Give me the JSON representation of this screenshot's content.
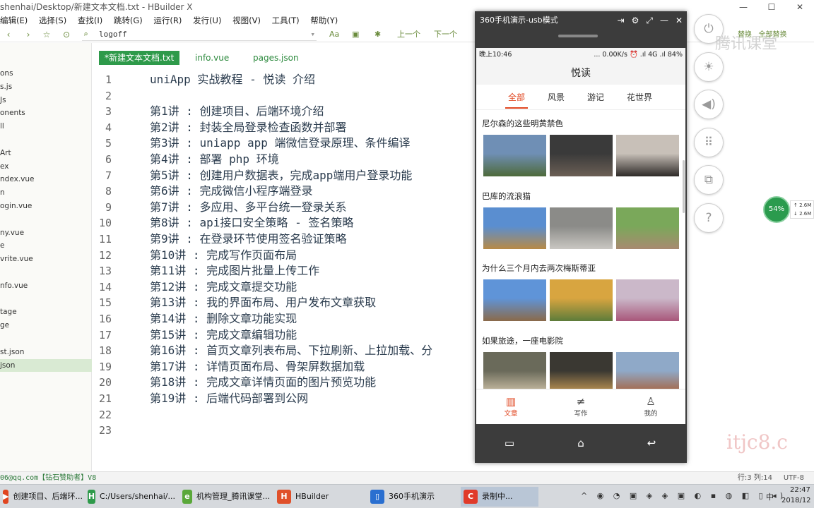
{
  "window": {
    "title": "shenhai/Desktop/新建文本文档.txt - HBuilder X",
    "controls": [
      "—",
      "☐",
      "✕"
    ]
  },
  "menu": [
    "编辑(E)",
    "选择(S)",
    "查找(I)",
    "跳转(G)",
    "运行(R)",
    "发行(U)",
    "视图(V)",
    "工具(T)",
    "帮助(Y)"
  ],
  "toolbar": {
    "address": "logoff",
    "buttons": [
      "Aa",
      "上一个",
      "下一个",
      "替换",
      "全部替换"
    ]
  },
  "sidebar": {
    "files": [
      "ons",
      "s.js",
      "Js",
      "onents",
      "ll",
      "",
      "Art",
      "ex",
      "ndex.vue",
      "n",
      "ogin.vue",
      "",
      "ny.vue",
      "e",
      "vrite.vue",
      "",
      "nfo.vue",
      "",
      "tage",
      "ge",
      "",
      "st.json",
      "json"
    ],
    "selected_index": 22
  },
  "tabs": [
    "*新建文本文档.txt",
    "info.vue",
    "pages.json"
  ],
  "editor": {
    "lines": [
      "uniApp 实战教程 - 悦读 介绍",
      "",
      "第1讲 : 创建项目、后端环境介绍",
      "第2讲 : 封装全局登录检查函数并部署",
      "第3讲 : uniapp app 端微信登录原理、条件编译",
      "第4讲 : 部署 php 环境",
      "第5讲 : 创建用户数据表，完成app端用户登录功能",
      "第6讲 : 完成微信小程序端登录",
      "第7讲 : 多应用、多平台统一登录关系",
      "第8讲 : api接口安全策略 - 签名策略",
      "第9讲 : 在登录环节使用签名验证策略",
      "第10讲 : 完成写作页面布局",
      "第11讲 : 完成图片批量上传工作",
      "第12讲 : 完成文章提交功能",
      "第13讲 : 我的界面布局、用户发布文章获取",
      "第14讲 : 删除文章功能实现",
      "第15讲 : 完成文章编辑功能",
      "第16讲 : 首页文章列表布局、下拉刷新、上拉加载、分",
      "第17讲 : 详情页面布局、骨架屏数据加载",
      "第18讲 : 完成文章详情页面的图片预览功能",
      "第19讲 : 后端代码部署到公网",
      "",
      ""
    ]
  },
  "statusbar": {
    "left": "06@qq.com【钻石赞助者】V8",
    "position": "行:3  列:14",
    "encoding": "UTF-8"
  },
  "phone": {
    "window_title": "360手机演示-usb模式",
    "status": {
      "time": "晚上10:46",
      "right": "... 0.00K/s ⏰ .ıl 4G .ıl 84%"
    },
    "app_title": "悦读",
    "tabs": [
      "全部",
      "风景",
      "游记",
      "花世界"
    ],
    "active_tab": 0,
    "articles": [
      {
        "title": "尼尔森的这些明黄禁色",
        "colors": [
          [
            "#6f8fb5",
            "#4e6a3a"
          ],
          [
            "#3a3a3a",
            "#6b5f55"
          ],
          [
            "#c8c0b8",
            "#2e2a28"
          ]
        ]
      },
      {
        "title": "巴库的流浪猫",
        "colors": [
          [
            "#5a8ed0",
            "#b88a45"
          ],
          [
            "#8b8b88",
            "#c9c7c2"
          ],
          [
            "#7aa85a",
            "#a88a70"
          ]
        ]
      },
      {
        "title": "为什么三个月内去两次梅斯蒂亚",
        "colors": [
          [
            "#5f94d8",
            "#8a6a4a"
          ],
          [
            "#d8a540",
            "#5d7c3a"
          ],
          [
            "#cbb8c9",
            "#a8567a"
          ]
        ]
      },
      {
        "title": "如果旅途，一座电影院",
        "colors": [
          [
            "#6a6a5a",
            "#cfc2a8"
          ],
          [
            "#3a3832",
            "#c59a55"
          ],
          [
            "#8fa9c8",
            "#a8603a"
          ]
        ]
      }
    ],
    "nav": [
      {
        "label": "文章",
        "icon": "book-icon"
      },
      {
        "label": "写作",
        "icon": "write-icon"
      },
      {
        "label": "我的",
        "icon": "user-icon"
      }
    ],
    "active_nav": 0
  },
  "controls": [
    "power-icon",
    "brightness-icon",
    "volume-icon",
    "keypad-icon",
    "screenshot-icon",
    "help-icon"
  ],
  "right_links": [
    "替换",
    "全部替换"
  ],
  "speed": {
    "percent": "54%",
    "up": "2.6M",
    "down": "2.6M"
  },
  "taskbar": {
    "items": [
      {
        "label": "创建项目、后端环...",
        "icon_color": "#e0451f",
        "icon_text": "▶"
      },
      {
        "label": "C:/Users/shenhai/...",
        "icon_color": "#2e9a4a",
        "icon_text": "H"
      },
      {
        "label": "机构管理_腾讯课堂...",
        "icon_color": "#5aa83a",
        "icon_text": "e"
      },
      {
        "label": "HBuilder",
        "icon_color": "#e0502a",
        "icon_text": "H"
      },
      {
        "label": "360手机演示",
        "icon_color": "#2a6fd0",
        "icon_text": "▯"
      },
      {
        "label": "录制中...",
        "icon_color": "#e03a2a",
        "icon_text": "C"
      }
    ],
    "clock_time": "22:47",
    "clock_date": "2018/12",
    "ime": "中"
  },
  "watermark": "itjc8.c",
  "brand_watermark": "腾讯课堂"
}
